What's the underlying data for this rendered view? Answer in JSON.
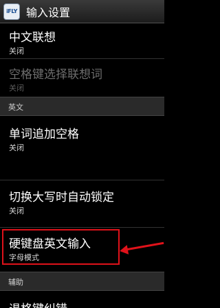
{
  "titlebar": {
    "icon_text": "iFLY",
    "title": "输入设置"
  },
  "items": [
    {
      "label": "中文联想",
      "value": "关闭",
      "disabled": false
    },
    {
      "label": "空格键选择联想词",
      "value": "关闭",
      "disabled": true
    },
    {
      "label": "单词追加空格",
      "value": "关闭",
      "disabled": false
    },
    {
      "label": "切换大写时自动锁定",
      "value": "关闭",
      "disabled": false
    },
    {
      "label": "硬键盘英文输入",
      "value": "字母模式",
      "disabled": false
    },
    {
      "label": "退格键纠错",
      "value": "",
      "disabled": false
    }
  ],
  "sections": {
    "english": "英文",
    "assist": "辅助"
  },
  "annotation": {
    "color": "#e0121a"
  }
}
